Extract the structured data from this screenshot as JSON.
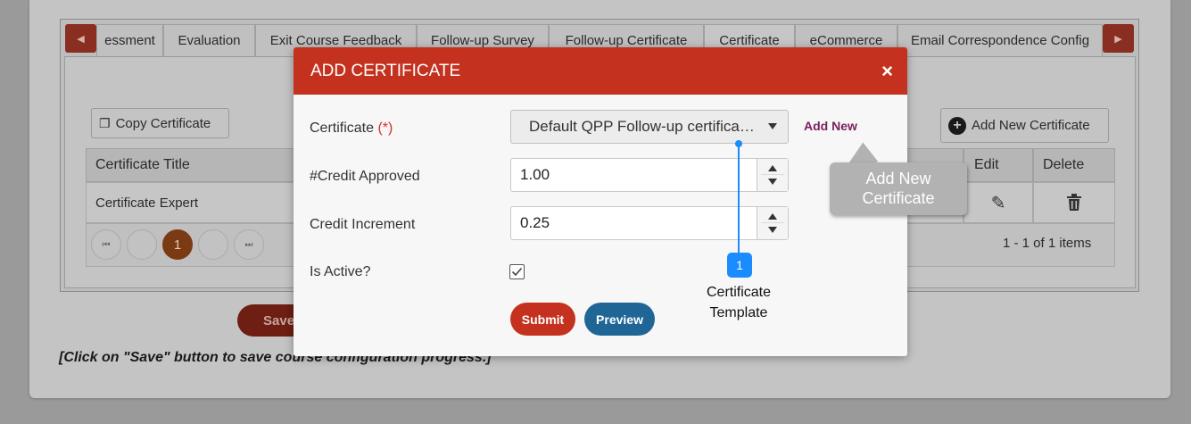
{
  "tabs": [
    "essment",
    "Evaluation",
    "Exit Course Feedback",
    "Follow-up Survey",
    "Follow-up Certificate",
    "Certificate",
    "eCommerce",
    "Email Correspondence Config"
  ],
  "active_tab": "Certificate",
  "grid": {
    "copy_button": "Copy Certificate",
    "add_button": "Add New Certificate",
    "columns": {
      "title": "Certificate Title",
      "edit": "Edit",
      "delete": "Delete"
    },
    "rows": [
      {
        "title": "Certificate Expert"
      }
    ],
    "pager": {
      "current_page": "1",
      "summary": "1 - 1 of 1 items"
    }
  },
  "save_button": "Save",
  "save_note": "[Click on \"Save\" button to save course configuration progress.]",
  "modal": {
    "title": "ADD CERTIFICATE",
    "close": "×",
    "certificate_label": "Certificate ",
    "required_mark": "(*)",
    "certificate_value": "Default QPP Follow-up certifica…",
    "add_new_link": "Add New",
    "credit_label": "#Credit Approved",
    "credit_value": "1.00",
    "increment_label": "Credit Increment",
    "increment_value": "0.25",
    "active_label": "Is Active?",
    "active_checked": true,
    "submit": "Submit",
    "preview": "Preview"
  },
  "annotations": {
    "badge": "1",
    "callout_text": "Certificate Template",
    "tooltip_text": "Add New Certificate"
  },
  "colors": {
    "modal_header": "#c4321f",
    "submit": "#c4321f",
    "preview": "#1f6696",
    "callout": "#1a8cff",
    "link": "#7a1f5a"
  }
}
